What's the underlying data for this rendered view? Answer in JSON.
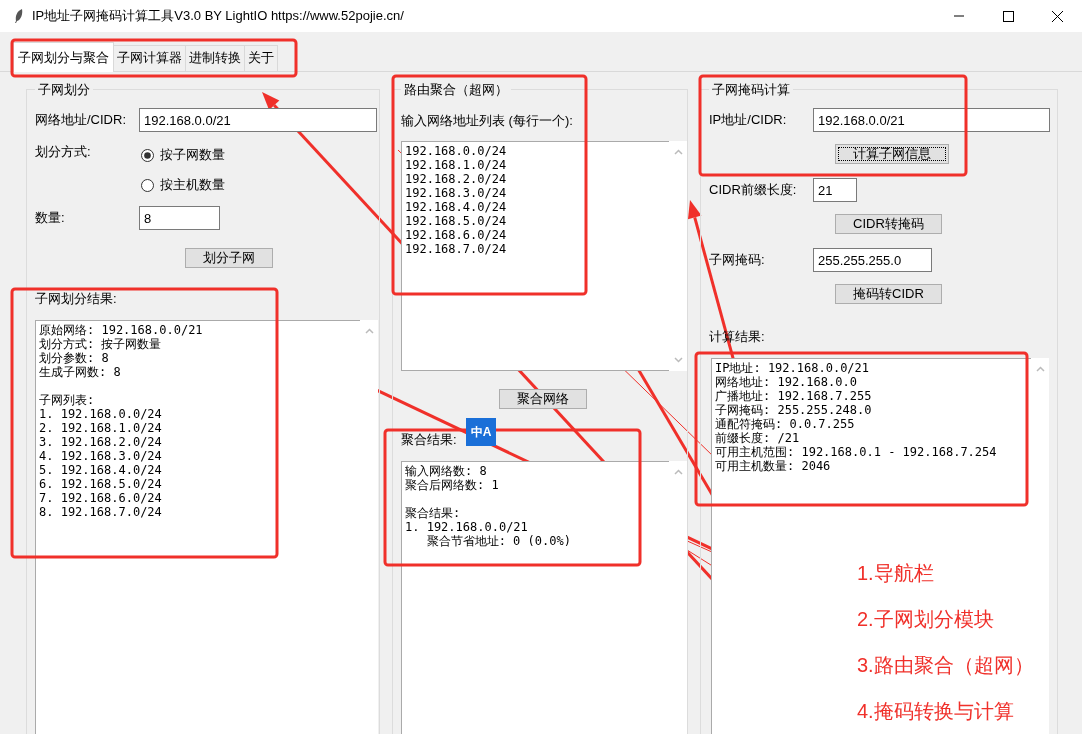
{
  "window": {
    "title": "IP地址子网掩码计算工具V3.0 BY LightIO https://www.52pojie.cn/"
  },
  "tabs": [
    {
      "label": "子网划分与聚合",
      "selected": true
    },
    {
      "label": "子网计算器",
      "selected": false
    },
    {
      "label": "进制转换",
      "selected": false
    },
    {
      "label": "关于",
      "selected": false
    }
  ],
  "panels": [
    {
      "title": "子网划分",
      "items": [
        {
          "kind": "field",
          "label": "网络地址/CIDR:",
          "value": "192.168.0.0/21"
        },
        {
          "kind": "radios",
          "label": "划分方式:",
          "options": [
            {
              "label": "按子网数量",
              "selected": true
            },
            {
              "label": "按主机数量",
              "selected": false
            }
          ]
        },
        {
          "kind": "field",
          "label": "数量:",
          "value": "8"
        },
        {
          "kind": "button",
          "label": "划分子网",
          "focused": false
        },
        {
          "kind": "output",
          "label": "子网划分结果:",
          "paragraphs": [
            [
              "原始网络: 192.168.0.0/21",
              "划分方式: 按子网数量",
              "划分参数: 8",
              "生成子网数: 8"
            ],
            [
              "子网列表:",
              "1. 192.168.0.0/24",
              "2. 192.168.1.0/24",
              "3. 192.168.2.0/24",
              "4. 192.168.3.0/24",
              "5. 192.168.4.0/24",
              "6. 192.168.5.0/24",
              "7. 192.168.6.0/24",
              "8. 192.168.7.0/24"
            ]
          ]
        }
      ]
    },
    {
      "title": "路由聚合（超网）",
      "items": [
        {
          "kind": "caption",
          "label": "输入网络地址列表 (每行一个):"
        },
        {
          "kind": "editor",
          "paragraphs": [
            [
              "192.168.0.0/24",
              "192.168.1.0/24",
              "192.168.2.0/24",
              "192.168.3.0/24",
              "192.168.4.0/24",
              "192.168.5.0/24",
              "192.168.6.0/24",
              "192.168.7.0/24"
            ]
          ]
        },
        {
          "kind": "button",
          "label": "聚合网络",
          "focused": false
        },
        {
          "kind": "output",
          "label": "聚合结果:",
          "paragraphs": [
            [
              "输入网络数: 8",
              "聚合后网络数: 1"
            ],
            [
              "聚合结果:",
              "1. 192.168.0.0/21",
              "   聚合节省地址: 0 (0.0%)"
            ]
          ]
        }
      ]
    },
    {
      "title": "子网掩码计算",
      "items": [
        {
          "kind": "field",
          "label": "IP地址/CIDR:",
          "value": "192.168.0.0/21"
        },
        {
          "kind": "button",
          "label": "计算子网信息",
          "focused": true
        },
        {
          "kind": "field",
          "label": "CIDR前缀长度:",
          "value": "21"
        },
        {
          "kind": "button",
          "label": "CIDR转掩码",
          "focused": false
        },
        {
          "kind": "field",
          "label": "子网掩码:",
          "value": "255.255.255.0"
        },
        {
          "kind": "button",
          "label": "掩码转CIDR",
          "focused": false
        },
        {
          "kind": "output",
          "label": "计算结果:",
          "paragraphs": [
            [
              "IP地址: 192.168.0.0/21",
              "网络地址: 192.168.0.0",
              "广播地址: 192.168.7.255",
              "子网掩码: 255.255.248.0",
              "通配符掩码: 0.0.7.255",
              "前缀长度: /21",
              "可用主机范围: 192.168.0.1 - 192.168.7.254",
              "可用主机数量: 2046"
            ]
          ]
        }
      ]
    }
  ],
  "translate_badge": {
    "text": "中A"
  },
  "annotation_labels": [
    "1.导航栏",
    "2.子网划分模块",
    "3.路由聚合（超网）",
    "4.掩码转换与计算"
  ]
}
